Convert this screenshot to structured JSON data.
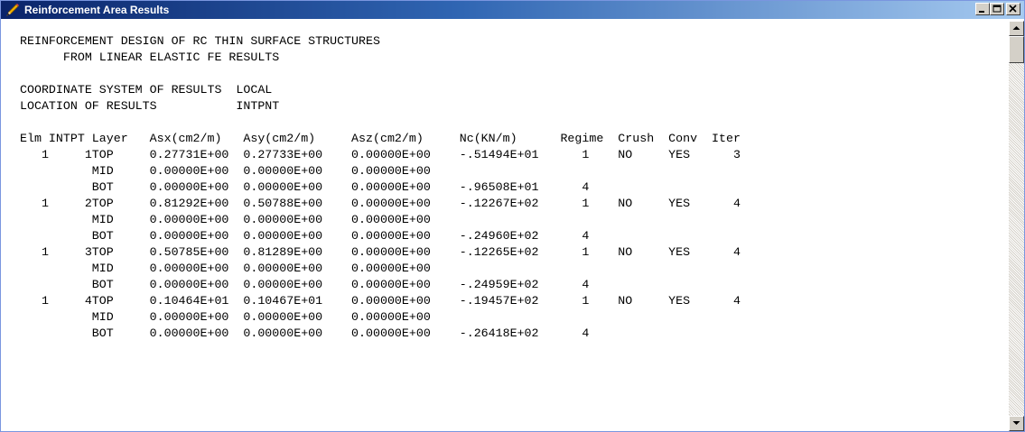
{
  "window": {
    "title": "Reinforcement Area Results",
    "icon": "pencil-icon",
    "controls": {
      "minimize": "minimize-icon",
      "maximize": "maximize-icon",
      "close": "close-icon"
    }
  },
  "report": {
    "heading_line1": "REINFORCEMENT DESIGN OF RC THIN SURFACE STRUCTURES",
    "heading_line2": "FROM LINEAR ELASTIC FE RESULTS",
    "coordinate_system_label": "COORDINATE SYSTEM OF RESULTS",
    "coordinate_system_value": "LOCAL",
    "location_label": "LOCATION OF RESULTS",
    "location_value": "INTPNT",
    "columns": [
      "Elm",
      "INTPT",
      "Layer",
      "Asx(cm2/m)",
      "Asy(cm2/m)",
      "Asz(cm2/m)",
      "Nc(KN/m)",
      "Regime",
      "Crush",
      "Conv",
      "Iter"
    ],
    "rows": [
      [
        "1",
        "1",
        "TOP",
        "0.27731E+00",
        "0.27733E+00",
        "0.00000E+00",
        "-.51494E+01",
        "1",
        "NO",
        "YES",
        "3"
      ],
      [
        "",
        "",
        "MID",
        "0.00000E+00",
        "0.00000E+00",
        "0.00000E+00",
        "",
        "",
        "",
        "",
        ""
      ],
      [
        "",
        "",
        "BOT",
        "0.00000E+00",
        "0.00000E+00",
        "0.00000E+00",
        "-.96508E+01",
        "4",
        "",
        "",
        ""
      ],
      [
        "1",
        "2",
        "TOP",
        "0.81292E+00",
        "0.50788E+00",
        "0.00000E+00",
        "-.12267E+02",
        "1",
        "NO",
        "YES",
        "4"
      ],
      [
        "",
        "",
        "MID",
        "0.00000E+00",
        "0.00000E+00",
        "0.00000E+00",
        "",
        "",
        "",
        "",
        ""
      ],
      [
        "",
        "",
        "BOT",
        "0.00000E+00",
        "0.00000E+00",
        "0.00000E+00",
        "-.24960E+02",
        "4",
        "",
        "",
        ""
      ],
      [
        "1",
        "3",
        "TOP",
        "0.50785E+00",
        "0.81289E+00",
        "0.00000E+00",
        "-.12265E+02",
        "1",
        "NO",
        "YES",
        "4"
      ],
      [
        "",
        "",
        "MID",
        "0.00000E+00",
        "0.00000E+00",
        "0.00000E+00",
        "",
        "",
        "",
        "",
        ""
      ],
      [
        "",
        "",
        "BOT",
        "0.00000E+00",
        "0.00000E+00",
        "0.00000E+00",
        "-.24959E+02",
        "4",
        "",
        "",
        ""
      ],
      [
        "1",
        "4",
        "TOP",
        "0.10464E+01",
        "0.10467E+01",
        "0.00000E+00",
        "-.19457E+02",
        "1",
        "NO",
        "YES",
        "4"
      ],
      [
        "",
        "",
        "MID",
        "0.00000E+00",
        "0.00000E+00",
        "0.00000E+00",
        "",
        "",
        "",
        "",
        ""
      ],
      [
        "",
        "",
        "BOT",
        "0.00000E+00",
        "0.00000E+00",
        "0.00000E+00",
        "-.26418E+02",
        "4",
        "",
        "",
        ""
      ]
    ]
  },
  "colors": {
    "titlebar_start": "#0a246a",
    "titlebar_end": "#a6caf0",
    "title_text": "#ffffff",
    "content_bg": "#ffffff",
    "text": "#000000"
  }
}
